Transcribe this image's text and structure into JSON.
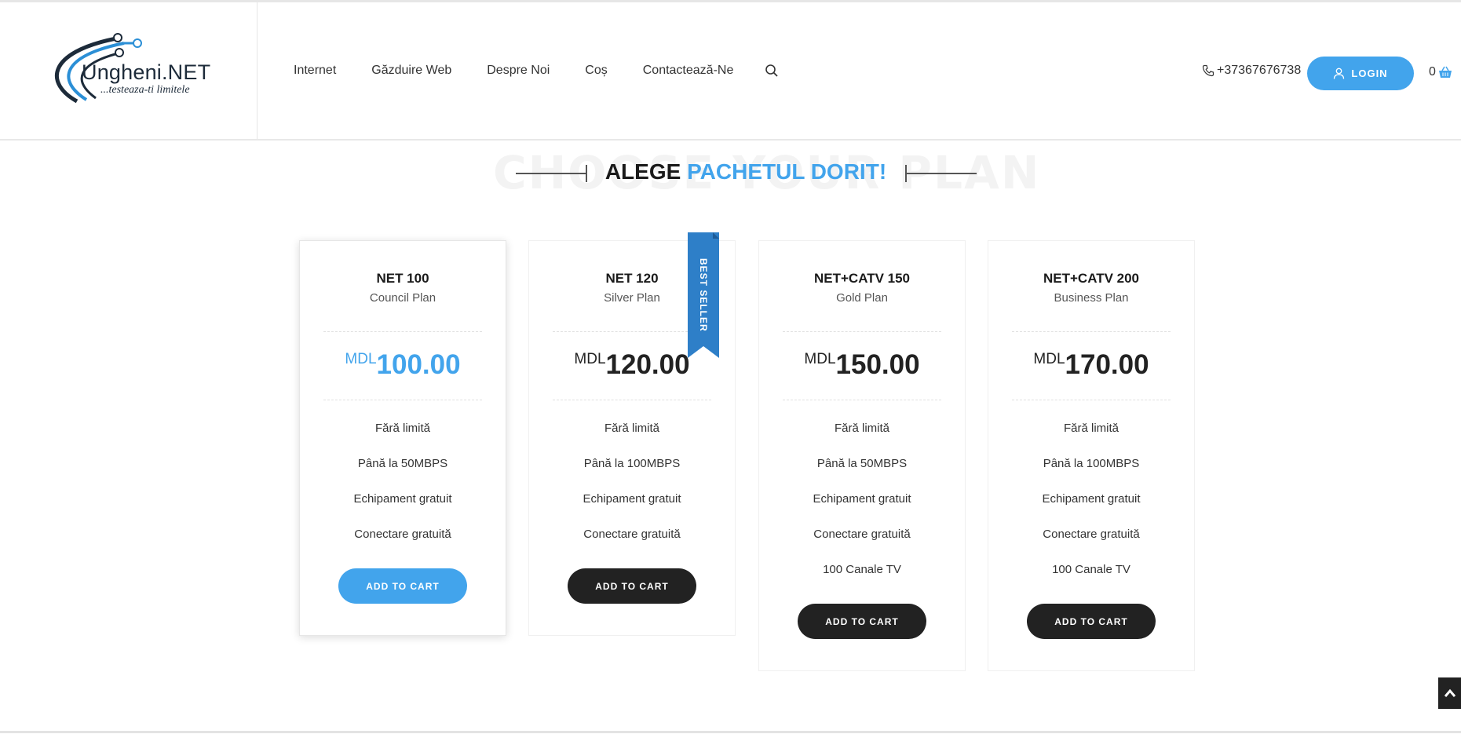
{
  "brand": {
    "name": "Ungheni.NET",
    "slogan": "...testeaza-ti limitele",
    "accent_color": "#42a4ec"
  },
  "nav": {
    "items": [
      {
        "label": "Internet"
      },
      {
        "label": "Găzduire Web"
      },
      {
        "label": "Despre Noi"
      },
      {
        "label": "Coș"
      },
      {
        "label": "Contactează-Ne"
      }
    ],
    "search_icon": "search-icon"
  },
  "header": {
    "phone": "+37367676738",
    "login_label": "LOGIN",
    "cart_count": "0"
  },
  "section": {
    "bg_title": "CHOOSE YOUR PLAN",
    "title_dark": "ALEGE",
    "title_blue": "PACHETUL DORIT!"
  },
  "plans": [
    {
      "name": "NET 100",
      "subtitle": "Council Plan",
      "currency": "MDL",
      "price": "100.00",
      "features": [
        "Fără limită",
        "Până la 50MBPS",
        "Echipament gratuit",
        "Conectare gratuită"
      ],
      "button": "ADD TO CART"
    },
    {
      "name": "NET 120",
      "subtitle": "Silver Plan",
      "currency": "MDL",
      "price": "120.00",
      "badge": "BEST SELLER",
      "features": [
        "Fără limită",
        "Până la 100MBPS",
        "Echipament gratuit",
        "Conectare gratuită"
      ],
      "button": "ADD TO CART"
    },
    {
      "name": "NET+CATV 150",
      "subtitle": "Gold Plan",
      "currency": "MDL",
      "price": "150.00",
      "features": [
        "Fără limită",
        "Până la 50MBPS",
        "Echipament gratuit",
        "Conectare gratuită",
        "100 Canale TV"
      ],
      "button": "ADD TO CART"
    },
    {
      "name": "NET+CATV 200",
      "subtitle": "Business Plan",
      "currency": "MDL",
      "price": "170.00",
      "features": [
        "Fără limită",
        "Până la 100MBPS",
        "Echipament gratuit",
        "Conectare gratuită",
        "100 Canale TV"
      ],
      "button": "ADD TO CART"
    }
  ]
}
